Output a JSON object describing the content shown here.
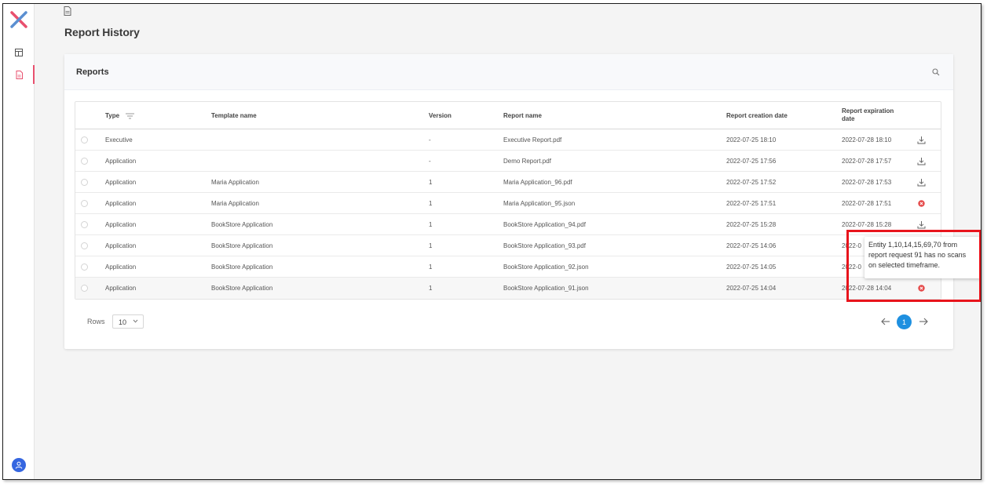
{
  "page": {
    "title": "Report History"
  },
  "card": {
    "title": "Reports"
  },
  "table": {
    "headers": {
      "type": "Type",
      "template_name": "Template name",
      "version": "Version",
      "report_name": "Report name",
      "creation_date": "Report creation date",
      "expiration_date_line1": "Report expiration",
      "expiration_date_line2": "date"
    },
    "rows": [
      {
        "type": "Executive",
        "template": "",
        "version": "-",
        "name": "Executive Report.pdf",
        "created": "2022-07-25 18:10",
        "expires": "2022-07-28 18:10",
        "action": "download"
      },
      {
        "type": "Application",
        "template": "",
        "version": "-",
        "name": "Demo Report.pdf",
        "created": "2022-07-25 17:56",
        "expires": "2022-07-28 17:57",
        "action": "download"
      },
      {
        "type": "Application",
        "template": "Maria Application",
        "version": "1",
        "name": "Maria Application_96.pdf",
        "created": "2022-07-25 17:52",
        "expires": "2022-07-28 17:53",
        "action": "download"
      },
      {
        "type": "Application",
        "template": "Maria Application",
        "version": "1",
        "name": "Maria Application_95.json",
        "created": "2022-07-25 17:51",
        "expires": "2022-07-28 17:51",
        "action": "error"
      },
      {
        "type": "Application",
        "template": "BookStore Application",
        "version": "1",
        "name": "BookStore Application_94.pdf",
        "created": "2022-07-25 15:28",
        "expires": "2022-07-28 15:28",
        "action": "download"
      },
      {
        "type": "Application",
        "template": "BookStore Application",
        "version": "1",
        "name": "BookStore Application_93.pdf",
        "created": "2022-07-25 14:06",
        "expires": "2022-0",
        "action": "none"
      },
      {
        "type": "Application",
        "template": "BookStore Application",
        "version": "1",
        "name": "BookStore Application_92.json",
        "created": "2022-07-25 14:05",
        "expires": "2022-0",
        "action": "none"
      },
      {
        "type": "Application",
        "template": "BookStore Application",
        "version": "1",
        "name": "BookStore Application_91.json",
        "created": "2022-07-25 14:04",
        "expires": "2022-07-28 14:04",
        "action": "error"
      }
    ]
  },
  "pagination": {
    "rows_label": "Rows",
    "rows_value": "10",
    "current_page": "1"
  },
  "tooltip": {
    "line1": "Entity 1,10,14,15,69,70 from",
    "line2": "report request 91 has no scans",
    "line3": "on selected timeframe."
  },
  "colors": {
    "accent": "#e8506e",
    "primary": "#1e90e0",
    "error": "#e54a4a",
    "highlight": "#e8141c",
    "avatar": "#3566e0"
  },
  "icons": {
    "logo": "x-logo-icon",
    "nav_1": "dashboard-icon",
    "nav_2": "report-document-icon",
    "search": "search-icon",
    "filter": "filter-icon",
    "download": "download-icon",
    "error": "error-circle-icon",
    "user": "user-icon"
  }
}
